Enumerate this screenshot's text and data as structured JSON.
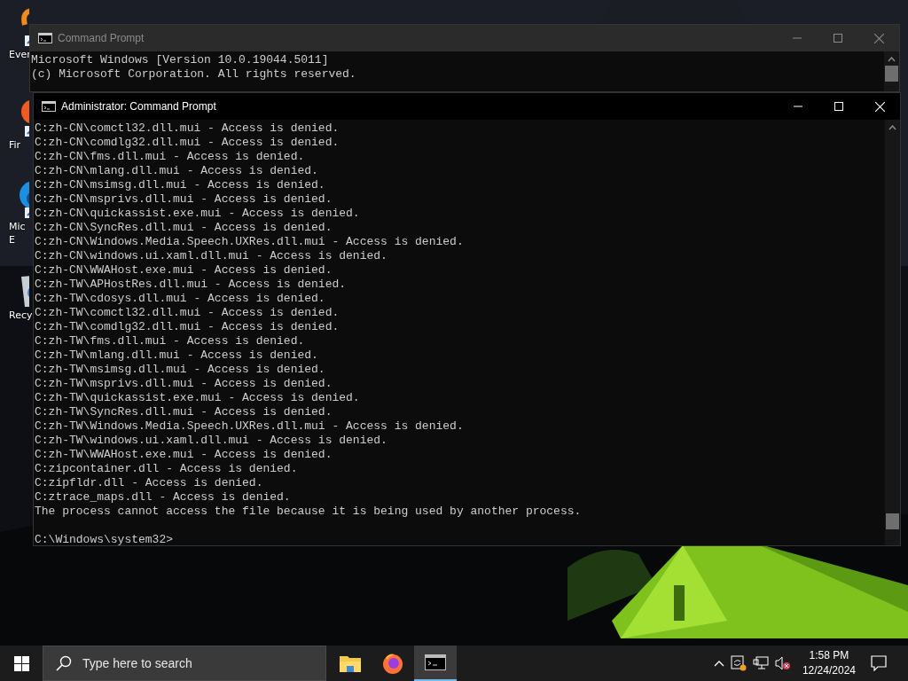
{
  "desktop": {
    "icons": [
      {
        "kind": "app",
        "label": [
          "Ever"
        ]
      },
      {
        "kind": "firefox",
        "label": [
          "Fir"
        ]
      },
      {
        "kind": "edge",
        "label": [
          "Mic",
          "E"
        ]
      },
      {
        "kind": "recycle",
        "label": [
          "Recy"
        ]
      }
    ]
  },
  "windows": [
    {
      "title": "Command Prompt",
      "active": false,
      "lines": [
        "Microsoft Windows [Version 10.0.19044.5011]",
        "(c) Microsoft Corporation. All rights reserved."
      ]
    },
    {
      "title": "Administrator: Command Prompt",
      "active": true,
      "lines": [
        "C:zh-CN\\comctl32.dll.mui - Access is denied.",
        "C:zh-CN\\comdlg32.dll.mui - Access is denied.",
        "C:zh-CN\\fms.dll.mui - Access is denied.",
        "C:zh-CN\\mlang.dll.mui - Access is denied.",
        "C:zh-CN\\msimsg.dll.mui - Access is denied.",
        "C:zh-CN\\msprivs.dll.mui - Access is denied.",
        "C:zh-CN\\quickassist.exe.mui - Access is denied.",
        "C:zh-CN\\SyncRes.dll.mui - Access is denied.",
        "C:zh-CN\\Windows.Media.Speech.UXRes.dll.mui - Access is denied.",
        "C:zh-CN\\windows.ui.xaml.dll.mui - Access is denied.",
        "C:zh-CN\\WWAHost.exe.mui - Access is denied.",
        "C:zh-TW\\APHostRes.dll.mui - Access is denied.",
        "C:zh-TW\\cdosys.dll.mui - Access is denied.",
        "C:zh-TW\\comctl32.dll.mui - Access is denied.",
        "C:zh-TW\\comdlg32.dll.mui - Access is denied.",
        "C:zh-TW\\fms.dll.mui - Access is denied.",
        "C:zh-TW\\mlang.dll.mui - Access is denied.",
        "C:zh-TW\\msimsg.dll.mui - Access is denied.",
        "C:zh-TW\\msprivs.dll.mui - Access is denied.",
        "C:zh-TW\\quickassist.exe.mui - Access is denied.",
        "C:zh-TW\\SyncRes.dll.mui - Access is denied.",
        "C:zh-TW\\Windows.Media.Speech.UXRes.dll.mui - Access is denied.",
        "C:zh-TW\\windows.ui.xaml.dll.mui - Access is denied.",
        "C:zh-TW\\WWAHost.exe.mui - Access is denied.",
        "C:zipcontainer.dll - Access is denied.",
        "C:zipfldr.dll - Access is denied.",
        "C:ztrace_maps.dll - Access is denied.",
        "The process cannot access the file because it is being used by another process."
      ],
      "prompt": "C:\\Windows\\system32>"
    }
  ],
  "taskbar": {
    "search": {
      "placeholder": "Type here to search"
    },
    "apps": [
      {
        "kind": "folder",
        "selected": false
      },
      {
        "kind": "firefox",
        "selected": false
      },
      {
        "kind": "terminal",
        "selected": true
      }
    ],
    "clock": {
      "time": "1:58 PM",
      "date": "12/24/2024"
    }
  }
}
